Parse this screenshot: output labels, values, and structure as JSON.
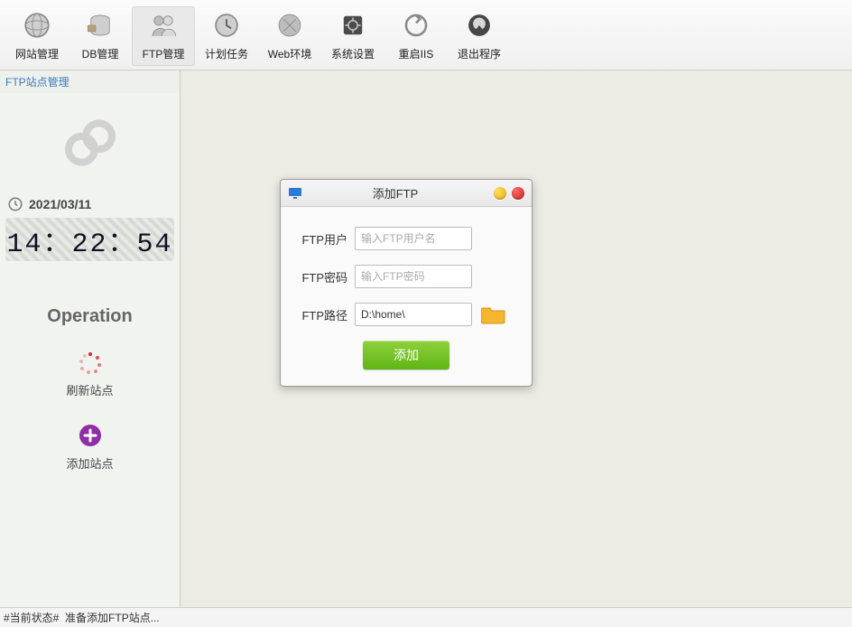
{
  "toolbar": {
    "items": [
      {
        "label": "网站管理",
        "icon": "globe"
      },
      {
        "label": "DB管理",
        "icon": "db"
      },
      {
        "label": "FTP管理",
        "icon": "users",
        "active": true
      },
      {
        "label": "计划任务",
        "icon": "clockgear"
      },
      {
        "label": "Web环境",
        "icon": "sparkglobe"
      },
      {
        "label": "系统设置",
        "icon": "gearbox"
      },
      {
        "label": "重启IIS",
        "icon": "refresh"
      },
      {
        "label": "退出程序",
        "icon": "exit"
      }
    ]
  },
  "sidebar": {
    "title": "FTP站点管理",
    "date": "2021/03/11",
    "time": "14：22：54",
    "opTitle": "Operation",
    "refreshLabel": "刷新站点",
    "addLabel": "添加站点"
  },
  "dialog": {
    "title": "添加FTP",
    "fields": {
      "userLabel": "FTP用户",
      "userPlaceholder": "输入FTP用户名",
      "userValue": "",
      "passLabel": "FTP密码",
      "passPlaceholder": "输入FTP密码",
      "passValue": "",
      "pathLabel": "FTP路径",
      "pathValue": "D:\\home\\"
    },
    "submitLabel": "添加"
  },
  "statusbar": {
    "prefix": "#当前状态#",
    "text": "准备添加FTP站点..."
  }
}
